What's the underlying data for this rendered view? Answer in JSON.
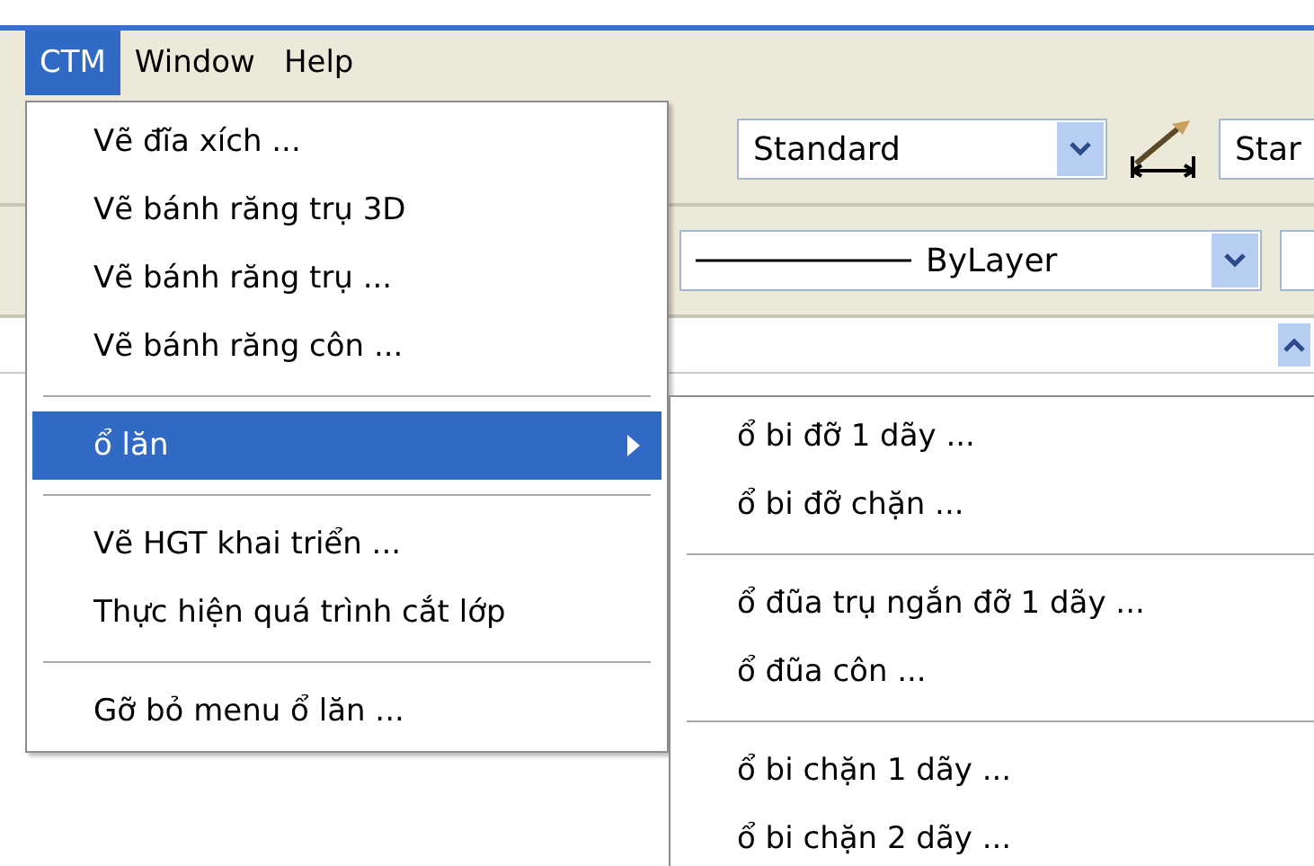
{
  "menubar": [
    {
      "label": "CTM",
      "selected": true
    },
    {
      "label": "Window",
      "selected": false
    },
    {
      "label": "Help",
      "selected": false
    }
  ],
  "toolbar": {
    "style_combo": "Standard",
    "dim_style_combo": "Star",
    "linetype_combo": "ByLayer"
  },
  "menu": [
    {
      "kind": "item",
      "label": "Vẽ đĩa xích ...",
      "selected": false
    },
    {
      "kind": "item",
      "label": "Vẽ bánh răng trụ 3D",
      "selected": false
    },
    {
      "kind": "item",
      "label": "Vẽ bánh răng trụ ...",
      "selected": false
    },
    {
      "kind": "item",
      "label": "Vẽ bánh răng côn ...",
      "selected": false
    },
    {
      "kind": "separator"
    },
    {
      "kind": "submenu",
      "label": "ổ lăn",
      "selected": true
    },
    {
      "kind": "separator"
    },
    {
      "kind": "item",
      "label": "Vẽ HGT khai triển ...",
      "selected": false
    },
    {
      "kind": "item",
      "label": "Thực hiện quá trình cắt lớp",
      "selected": false
    },
    {
      "kind": "separator"
    },
    {
      "kind": "item",
      "label": "Gỡ bỏ menu ổ lăn ...",
      "selected": false
    }
  ],
  "submenu": [
    {
      "kind": "item",
      "label": "ổ bi đỡ 1 dãy ...",
      "selected": false
    },
    {
      "kind": "item",
      "label": "ổ bi đỡ chặn ...",
      "selected": false
    },
    {
      "kind": "separator"
    },
    {
      "kind": "item",
      "label": "ổ đũa trụ ngắn đỡ 1 dãy ...",
      "selected": false
    },
    {
      "kind": "item",
      "label": "ổ đũa côn ...",
      "selected": false
    },
    {
      "kind": "separator"
    },
    {
      "kind": "item",
      "label": "ổ bi chặn 1 dãy ...",
      "selected": false
    },
    {
      "kind": "item",
      "label": "ổ bi chặn 2 dãy ...",
      "selected": false
    }
  ]
}
